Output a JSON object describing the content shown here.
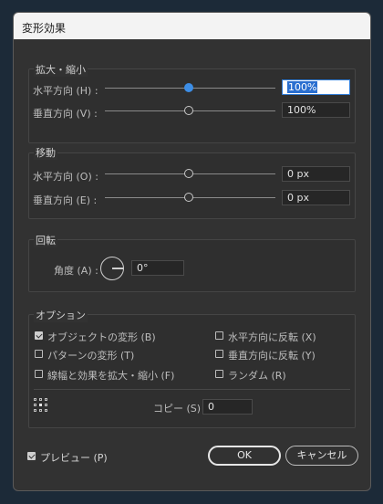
{
  "window": {
    "title": "変形効果"
  },
  "scale": {
    "title": "拡大・縮小",
    "horizontal_label": "水平方向 (H) :",
    "horizontal_value": "100%",
    "horizontal_level": 0.5,
    "vertical_label": "垂直方向 (V) :",
    "vertical_value": "100%",
    "vertical_level": 0.5
  },
  "move": {
    "title": "移動",
    "horizontal_label": "水平方向 (O) :",
    "horizontal_value": "0 px",
    "horizontal_level": 0.5,
    "vertical_label": "垂直方向 (E) :",
    "vertical_value": "0 px",
    "vertical_level": 0.5
  },
  "rotate": {
    "title": "回転",
    "angle_label": "角度 (A) :",
    "angle_value": "0°"
  },
  "options": {
    "title": "オプション",
    "transform_objects": {
      "label": "オブジェクトの変形 (B)",
      "checked": true
    },
    "transform_patterns": {
      "label": "パターンの変形 (T)",
      "checked": false
    },
    "scale_strokes": {
      "label": "線幅と効果を拡大・縮小 (F)",
      "checked": false
    },
    "reflect_x": {
      "label": "水平方向に反転 (X)",
      "checked": false
    },
    "reflect_y": {
      "label": "垂直方向に反転 (Y)",
      "checked": false
    },
    "random": {
      "label": "ランダム (R)",
      "checked": false
    }
  },
  "copies": {
    "label": "コピー (S)",
    "value": "0"
  },
  "preview": {
    "label": "プレビュー (P)",
    "checked": true
  },
  "buttons": {
    "ok": "OK",
    "cancel": "キャンセル"
  },
  "colors": {
    "accent": "#3d8ee6",
    "dialog_bg": "#323232",
    "titlebar_bg": "#f3f3f3"
  }
}
